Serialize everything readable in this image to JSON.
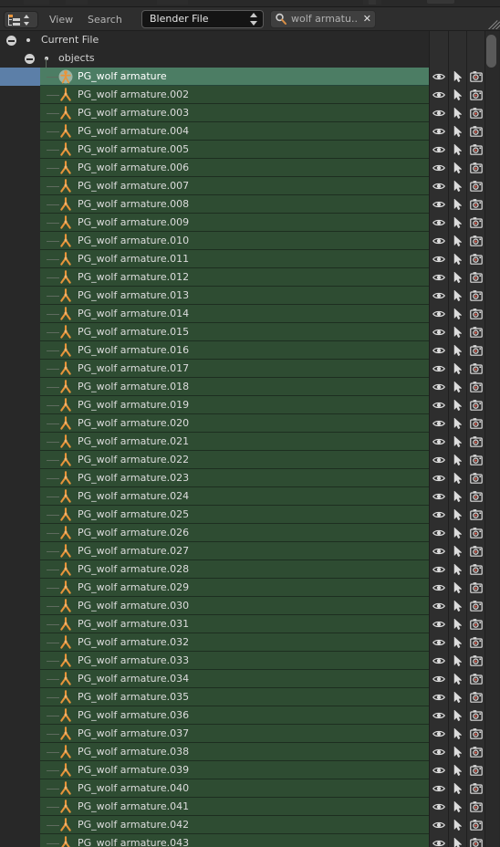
{
  "window": {
    "editor_type_icon": "outliner-editor-icon"
  },
  "header": {
    "menus": [
      {
        "label": "View",
        "name": "menu-view"
      },
      {
        "label": "Search",
        "name": "menu-search"
      }
    ],
    "display_mode": {
      "label": "Blender File",
      "icon": "chevron-updown-icon"
    },
    "search": {
      "icon": "magnifier-icon",
      "value": "wolf armatu..",
      "clear_icon": "close-icon"
    },
    "resize_grip_icon": "resize-grip-icon"
  },
  "tree": {
    "root": {
      "label": "Current File",
      "expanded": true
    },
    "group": {
      "label": "objects",
      "expanded": true
    },
    "restrict_columns": [
      {
        "name": "restrict-viewport-visibility",
        "icon": "eye-icon"
      },
      {
        "name": "restrict-selectability",
        "icon": "cursor-arrow-icon"
      },
      {
        "name": "restrict-renderability",
        "icon": "camera-icon"
      }
    ],
    "items": [
      {
        "label": "PG_wolf armature",
        "icon": "armature-object-icon",
        "selected": true
      },
      {
        "label": "PG_wolf armature.002",
        "icon": "armature-data-icon",
        "selected": false
      },
      {
        "label": "PG_wolf armature.003",
        "icon": "armature-data-icon",
        "selected": false
      },
      {
        "label": "PG_wolf armature.004",
        "icon": "armature-data-icon",
        "selected": false
      },
      {
        "label": "PG_wolf armature.005",
        "icon": "armature-data-icon",
        "selected": false
      },
      {
        "label": "PG_wolf armature.006",
        "icon": "armature-data-icon",
        "selected": false
      },
      {
        "label": "PG_wolf armature.007",
        "icon": "armature-data-icon",
        "selected": false
      },
      {
        "label": "PG_wolf armature.008",
        "icon": "armature-data-icon",
        "selected": false
      },
      {
        "label": "PG_wolf armature.009",
        "icon": "armature-data-icon",
        "selected": false
      },
      {
        "label": "PG_wolf armature.010",
        "icon": "armature-data-icon",
        "selected": false
      },
      {
        "label": "PG_wolf armature.011",
        "icon": "armature-data-icon",
        "selected": false
      },
      {
        "label": "PG_wolf armature.012",
        "icon": "armature-data-icon",
        "selected": false
      },
      {
        "label": "PG_wolf armature.013",
        "icon": "armature-data-icon",
        "selected": false
      },
      {
        "label": "PG_wolf armature.014",
        "icon": "armature-data-icon",
        "selected": false
      },
      {
        "label": "PG_wolf armature.015",
        "icon": "armature-data-icon",
        "selected": false
      },
      {
        "label": "PG_wolf armature.016",
        "icon": "armature-data-icon",
        "selected": false
      },
      {
        "label": "PG_wolf armature.017",
        "icon": "armature-data-icon",
        "selected": false
      },
      {
        "label": "PG_wolf armature.018",
        "icon": "armature-data-icon",
        "selected": false
      },
      {
        "label": "PG_wolf armature.019",
        "icon": "armature-data-icon",
        "selected": false
      },
      {
        "label": "PG_wolf armature.020",
        "icon": "armature-data-icon",
        "selected": false
      },
      {
        "label": "PG_wolf armature.021",
        "icon": "armature-data-icon",
        "selected": false
      },
      {
        "label": "PG_wolf armature.022",
        "icon": "armature-data-icon",
        "selected": false
      },
      {
        "label": "PG_wolf armature.023",
        "icon": "armature-data-icon",
        "selected": false
      },
      {
        "label": "PG_wolf armature.024",
        "icon": "armature-data-icon",
        "selected": false
      },
      {
        "label": "PG_wolf armature.025",
        "icon": "armature-data-icon",
        "selected": false
      },
      {
        "label": "PG_wolf armature.026",
        "icon": "armature-data-icon",
        "selected": false
      },
      {
        "label": "PG_wolf armature.027",
        "icon": "armature-data-icon",
        "selected": false
      },
      {
        "label": "PG_wolf armature.028",
        "icon": "armature-data-icon",
        "selected": false
      },
      {
        "label": "PG_wolf armature.029",
        "icon": "armature-data-icon",
        "selected": false
      },
      {
        "label": "PG_wolf armature.030",
        "icon": "armature-data-icon",
        "selected": false
      },
      {
        "label": "PG_wolf armature.031",
        "icon": "armature-data-icon",
        "selected": false
      },
      {
        "label": "PG_wolf armature.032",
        "icon": "armature-data-icon",
        "selected": false
      },
      {
        "label": "PG_wolf armature.033",
        "icon": "armature-data-icon",
        "selected": false
      },
      {
        "label": "PG_wolf armature.034",
        "icon": "armature-data-icon",
        "selected": false
      },
      {
        "label": "PG_wolf armature.035",
        "icon": "armature-data-icon",
        "selected": false
      },
      {
        "label": "PG_wolf armature.036",
        "icon": "armature-data-icon",
        "selected": false
      },
      {
        "label": "PG_wolf armature.037",
        "icon": "armature-data-icon",
        "selected": false
      },
      {
        "label": "PG_wolf armature.038",
        "icon": "armature-data-icon",
        "selected": false
      },
      {
        "label": "PG_wolf armature.039",
        "icon": "armature-data-icon",
        "selected": false
      },
      {
        "label": "PG_wolf armature.040",
        "icon": "armature-data-icon",
        "selected": false
      },
      {
        "label": "PG_wolf armature.041",
        "icon": "armature-data-icon",
        "selected": false
      },
      {
        "label": "PG_wolf armature.042",
        "icon": "armature-data-icon",
        "selected": false
      },
      {
        "label": "PG_wolf armature.043",
        "icon": "armature-data-icon",
        "selected": false
      }
    ]
  },
  "colors": {
    "background": "#282828",
    "header": "#2e2e2e",
    "row_green": "#2e4c32",
    "row_green_selected": "#4c7d64",
    "selection_block": "#5c7fa8",
    "text": "#d2d2d2",
    "icon_orange": "#e8943a"
  }
}
